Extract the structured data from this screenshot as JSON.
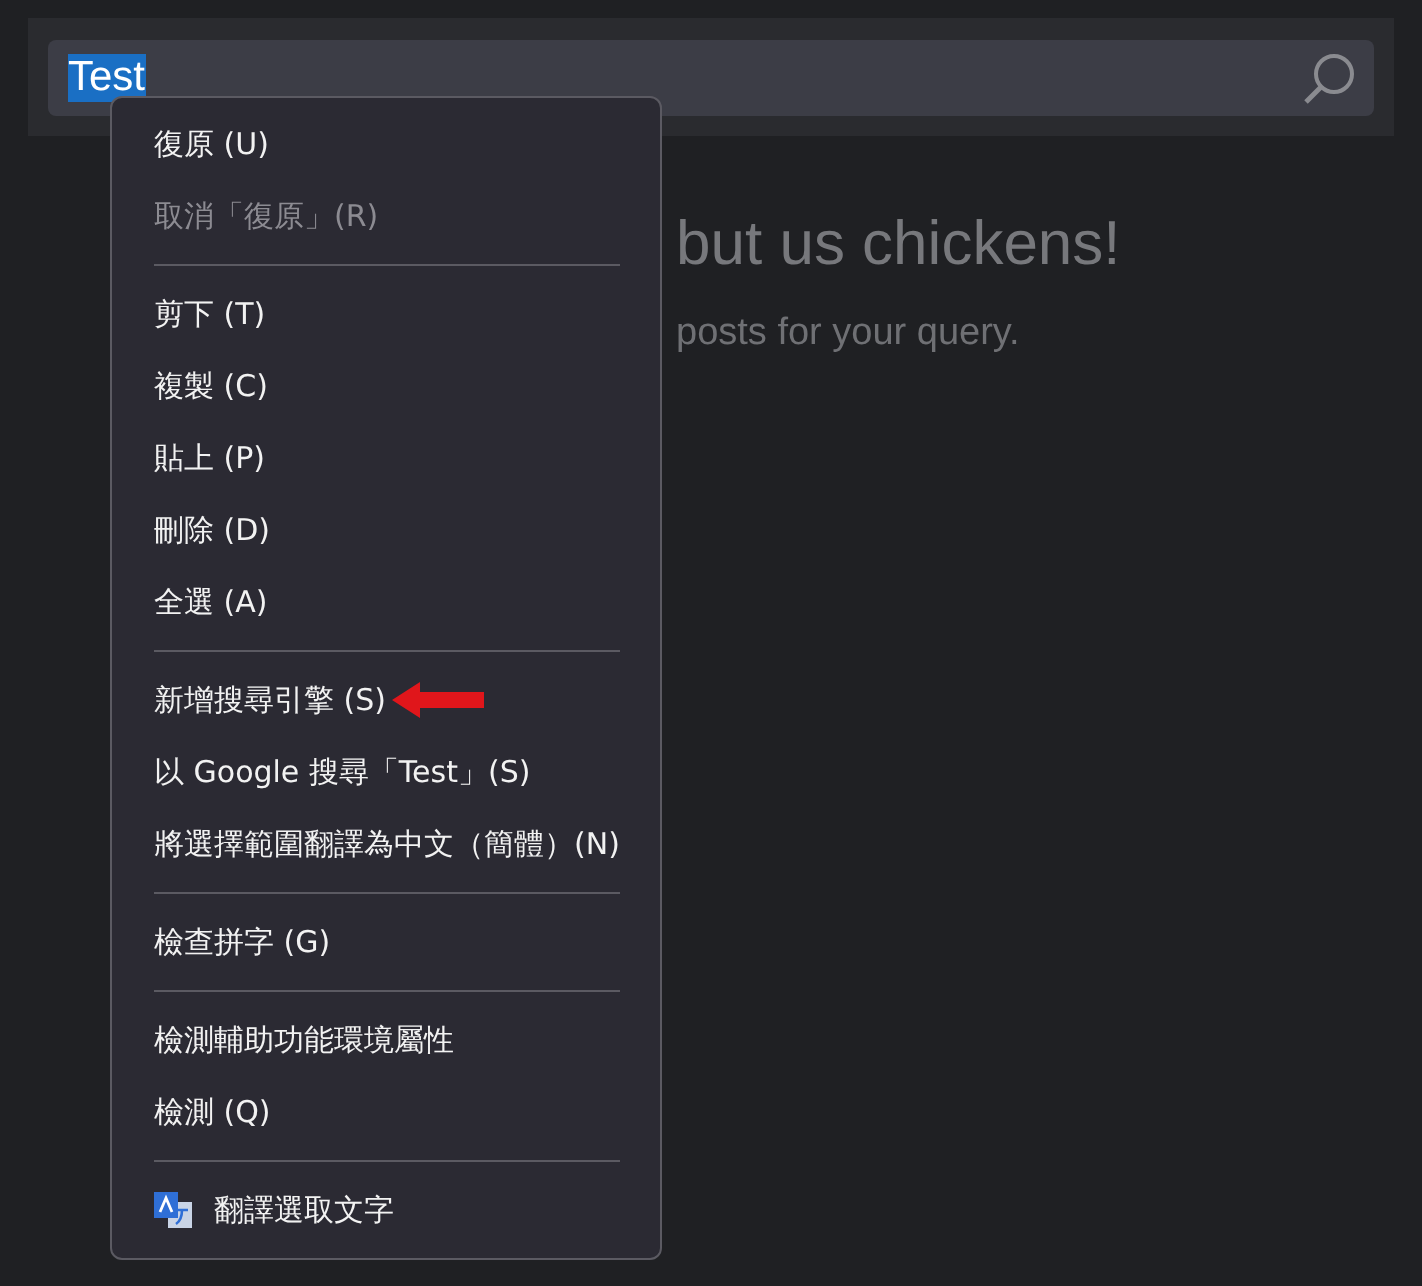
{
  "search": {
    "value": "Test",
    "selected": true
  },
  "page": {
    "headline": "but us chickens!",
    "subtext": "posts for your query."
  },
  "context_menu": {
    "items": [
      {
        "kind": "item",
        "label": "復原 (U)",
        "disabled": false
      },
      {
        "kind": "item",
        "label": "取消「復原」(R)",
        "disabled": true
      },
      {
        "kind": "separator"
      },
      {
        "kind": "item",
        "label": "剪下 (T)",
        "disabled": false
      },
      {
        "kind": "item",
        "label": "複製 (C)",
        "disabled": false
      },
      {
        "kind": "item",
        "label": "貼上 (P)",
        "disabled": false
      },
      {
        "kind": "item",
        "label": "刪除 (D)",
        "disabled": false
      },
      {
        "kind": "item",
        "label": "全選 (A)",
        "disabled": false
      },
      {
        "kind": "separator"
      },
      {
        "kind": "item",
        "label": "新增搜尋引擎 (S)",
        "disabled": false,
        "annotated": true
      },
      {
        "kind": "item",
        "label": "以 Google 搜尋「Test」(S)",
        "disabled": false
      },
      {
        "kind": "item",
        "label": "將選擇範圍翻譯為中文（簡體）(N)",
        "disabled": false
      },
      {
        "kind": "separator"
      },
      {
        "kind": "item",
        "label": "檢查拼字 (G)",
        "disabled": false
      },
      {
        "kind": "separator"
      },
      {
        "kind": "item",
        "label": "檢測輔助功能環境屬性",
        "disabled": false
      },
      {
        "kind": "item",
        "label": "檢測 (Q)",
        "disabled": false
      },
      {
        "kind": "separator"
      },
      {
        "kind": "icon-item",
        "label": "翻譯選取文字",
        "disabled": false
      }
    ]
  }
}
